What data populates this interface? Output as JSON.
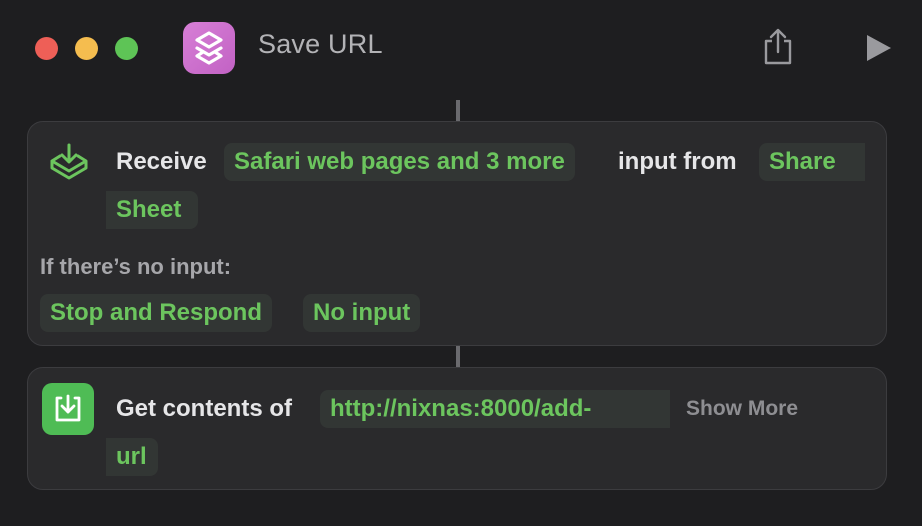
{
  "window": {
    "title": "Save URL",
    "icons": {
      "app": "shortcuts-app-icon",
      "share": "share-icon",
      "run": "play-icon"
    },
    "colors": {
      "close": "#ee5f57",
      "minimize": "#f5bd4f",
      "maximize": "#5ec456",
      "app_icon": "#cf72cf",
      "accent_green": "#6cc55e"
    }
  },
  "actions": [
    {
      "icon": "receive-tray-icon",
      "verb": "Receive",
      "input_types": "Safari web pages and 3 more",
      "connector_text": "input from",
      "source_line1": "Share",
      "source_line2": "Sheet",
      "no_input_label": "If there’s no input:",
      "no_input_action": "Stop and Respond",
      "no_input_response": "No input"
    },
    {
      "icon": "download-icon",
      "verb": "Get contents of",
      "url_line1": "http://nixnas:8000/add-",
      "url_line2": "url",
      "show_more": "Show More"
    }
  ]
}
